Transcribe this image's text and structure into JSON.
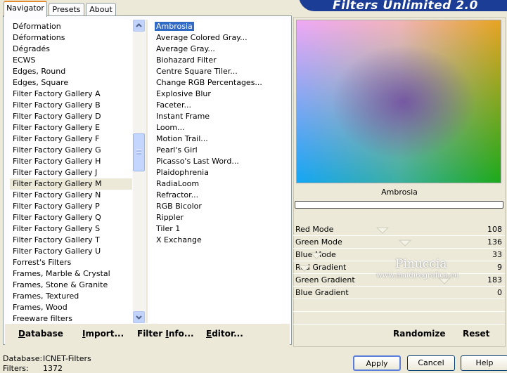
{
  "logo": {
    "text": "Filters Unlimited 2.0"
  },
  "tabs": [
    {
      "label": "Navigator",
      "active": true
    },
    {
      "label": "Presets",
      "active": false
    },
    {
      "label": "About",
      "active": false
    }
  ],
  "categories": [
    "Déformation",
    "Déformations",
    "Dégradés",
    "ECWS",
    "Edges, Round",
    "Edges, Square",
    "Filter Factory Gallery A",
    "Filter Factory Gallery B",
    "Filter Factory Gallery D",
    "Filter Factory Gallery E",
    "Filter Factory Gallery F",
    "Filter Factory Gallery G",
    "Filter Factory Gallery H",
    "Filter Factory Gallery J",
    "Filter Factory Gallery M",
    "Filter Factory Gallery N",
    "Filter Factory Gallery P",
    "Filter Factory Gallery Q",
    "Filter Factory Gallery S",
    "Filter Factory Gallery T",
    "Filter Factory Gallery U",
    "Forrest's Filters",
    "Frames, Marble & Crystal",
    "Frames, Stone & Granite",
    "Frames, Textured",
    "Frames, Wood",
    "Freeware filters"
  ],
  "selected_category": "Filter Factory Gallery M",
  "filters": [
    "Ambrosia",
    "Average Colored Gray...",
    "Average Gray...",
    "Biohazard Filter",
    "Centre Square Tiler...",
    "Change RGB Percentages...",
    "Explosive Blur",
    "Faceter...",
    "Instant Frame",
    "Loom...",
    "Motion Trail...",
    "Pearl's Girl",
    "Picasso's Last Word...",
    "Plaidophrenia",
    "RadiaLoom",
    "Refractor...",
    "RGB Bicolor",
    "Rippler",
    "Tiler 1",
    "X Exchange"
  ],
  "selected_filter": "Ambrosia",
  "preview": {
    "title": "Ambrosia",
    "progress": 0
  },
  "params": [
    {
      "name": "Red Mode",
      "value": "108"
    },
    {
      "name": "Green Mode",
      "value": "136"
    },
    {
      "name": "Blue Mode",
      "value": "33"
    },
    {
      "name": "Red Gradient",
      "value": "9"
    },
    {
      "name": "Green Gradient",
      "value": "183"
    },
    {
      "name": "Blue Gradient",
      "value": "0"
    }
  ],
  "watermark": {
    "line1": "Pinuccia",
    "line2": "www.maidiregrafica.eu"
  },
  "toolbar_left": {
    "database": {
      "underline": "D",
      "rest": "atabase"
    },
    "import": {
      "underline": "I",
      "rest": "mport..."
    },
    "filter_info": {
      "pre": "Filter ",
      "underline": "I",
      "rest": "nfo..."
    },
    "editor": {
      "underline": "E",
      "rest": "ditor..."
    }
  },
  "toolbar_right": {
    "randomize": "Randomize",
    "reset": "Reset"
  },
  "status": {
    "database_label": "Database:",
    "database_value": "ICNET-Filters",
    "filters_label": "Filters:",
    "filters_value": "1372"
  },
  "buttons": {
    "apply": "Apply",
    "cancel": "Cancel",
    "help": "Help"
  }
}
